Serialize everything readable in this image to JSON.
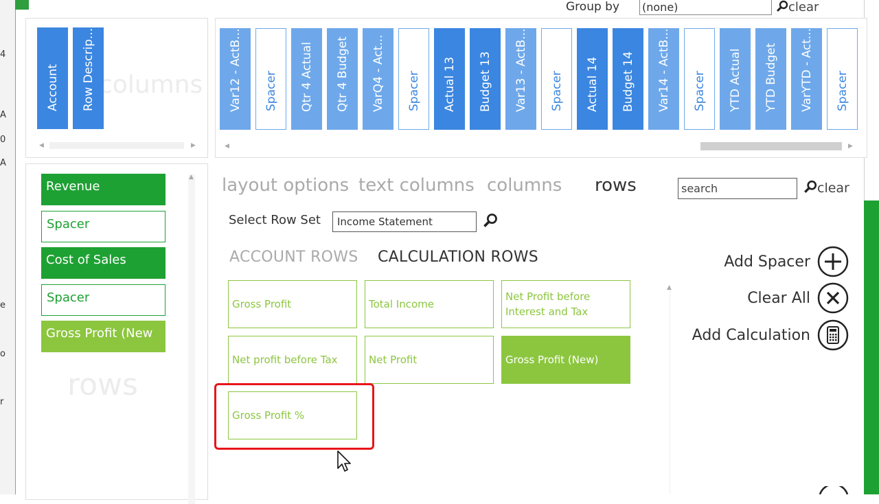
{
  "bg_fragments": [
    "4",
    "A",
    "0",
    "A",
    "e",
    "o",
    "r"
  ],
  "group_by": {
    "label": "Group by",
    "value": "(none)",
    "clear": "clear"
  },
  "text_columns_panel": {
    "watermark": "columns",
    "tiles": [
      {
        "label": "Account",
        "style": "dark"
      },
      {
        "label": "Row Descrip...",
        "style": "dark"
      }
    ]
  },
  "columns_panel": {
    "tiles": [
      {
        "label": "Var12 - ActB...",
        "style": "light"
      },
      {
        "label": "Spacer",
        "style": "spacer"
      },
      {
        "label": "Qtr 4 Actual",
        "style": "light"
      },
      {
        "label": "Qtr 4 Budget",
        "style": "light"
      },
      {
        "label": "VarQ4 - Act...",
        "style": "light"
      },
      {
        "label": "Spacer",
        "style": "spacer"
      },
      {
        "label": "Actual 13",
        "style": "dark"
      },
      {
        "label": "Budget 13",
        "style": "dark"
      },
      {
        "label": "Var13 - ActB...",
        "style": "light"
      },
      {
        "label": "Spacer",
        "style": "spacer"
      },
      {
        "label": "Actual 14",
        "style": "dark"
      },
      {
        "label": "Budget 14",
        "style": "dark"
      },
      {
        "label": "Var14 - ActB...",
        "style": "light"
      },
      {
        "label": "Spacer",
        "style": "spacer"
      },
      {
        "label": "YTD Actual",
        "style": "light"
      },
      {
        "label": "YTD Budget",
        "style": "light"
      },
      {
        "label": "VarYTD - Act...",
        "style": "light"
      },
      {
        "label": "Spacer",
        "style": "spacer"
      }
    ]
  },
  "rows_panel": {
    "watermark": "rows",
    "items": [
      {
        "label": "Revenue",
        "style": "green"
      },
      {
        "label": "Spacer",
        "style": "spacer"
      },
      {
        "label": "Cost of Sales",
        "style": "green"
      },
      {
        "label": "Spacer",
        "style": "spacer"
      },
      {
        "label": "Gross Profit (New",
        "style": "lime"
      }
    ]
  },
  "nav": {
    "layout_options": "layout options",
    "text_columns": "text columns",
    "columns": "columns",
    "rows": "rows"
  },
  "search": {
    "placeholder": "search",
    "clear": "clear"
  },
  "row_set": {
    "label": "Select Row Set",
    "value": "Income Statement"
  },
  "subtabs": {
    "account_rows": "ACCOUNT ROWS",
    "calculation_rows": "CALCULATION ROWS"
  },
  "calculations": [
    {
      "label": "Gross Profit",
      "selected": false
    },
    {
      "label": "Total Income",
      "selected": false
    },
    {
      "label": "Net Profit before Interest and Tax",
      "selected": false
    },
    {
      "label": "Net profit before Tax",
      "selected": false
    },
    {
      "label": "Net Profit",
      "selected": false
    },
    {
      "label": "Gross Profit (New)",
      "selected": true
    },
    {
      "label": "Gross Profit %",
      "selected": false
    }
  ],
  "actions": {
    "add_spacer": "Add Spacer",
    "clear_all": "Clear All",
    "add_calculation": "Add Calculation"
  },
  "colors": {
    "blue_dark": "#3b86e0",
    "blue_light": "#6ea8ea",
    "green": "#1ea133",
    "lime": "#8cc63f",
    "highlight": "#e8141b"
  }
}
